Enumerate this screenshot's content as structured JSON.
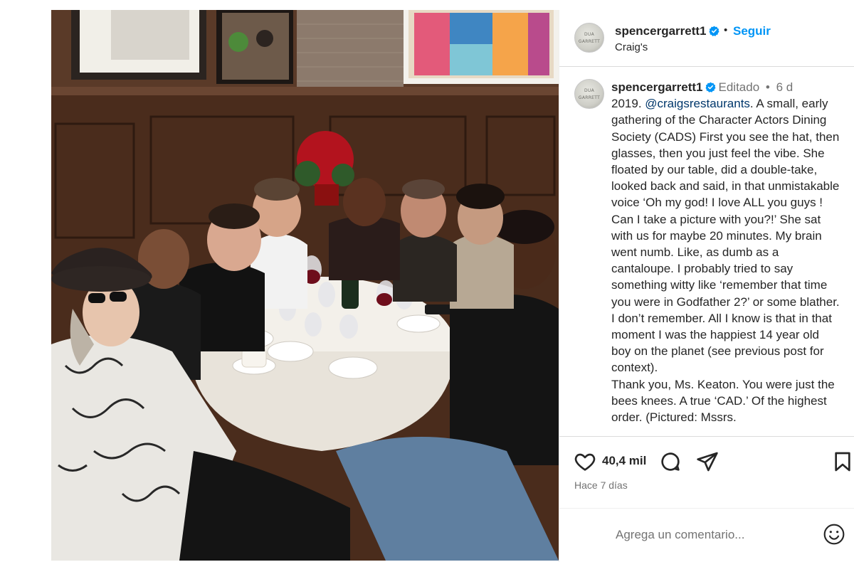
{
  "post": {
    "photo_alt": "",
    "header": {
      "username": "spencergarrett1",
      "dot": "•",
      "follow_label": "Seguir",
      "location": "Craig's",
      "avatar_text": [
        "DUA",
        "GARRETT"
      ]
    },
    "caption": {
      "username": "spencergarrett1",
      "edited": "Editado",
      "dot": "•",
      "age": "6 d",
      "year_prefix": "2019. ",
      "mention": "@craigsrestaurants",
      "text": ". A small, early gathering of the Character Actors Dining Society (CADS) First you see the hat, then glasses, then you just feel the vibe. She floated by our table, did a double-take, looked back and said, in that unmistakable voice ‘Oh my god! I love ALL you guys ! Can I take a picture with you?!’ She sat with us for maybe 20 minutes. My brain went numb. Like, as dumb as a cantaloupe. I probably tried to say something witty like ‘remember that time you were in Godfather 2?’ or some blather. I don’t remember. All I know is that in that moment I was the happiest 14 year old boy on the planet (see previous post for context).",
      "text2": "Thank you, Ms. Keaton. You were just the bees knees. A true ‘CAD.’ Of the highest order. (Pictured: Mssrs."
    },
    "actions": {
      "icons": [
        "heart-icon",
        "comment-icon",
        "share-icon",
        "bookmark-icon"
      ],
      "likes": "40,4 mil",
      "posted": "Hace 7 días"
    },
    "comment": {
      "placeholder": "Agrega un comentario...",
      "icon": "emoji-icon"
    },
    "colors": {
      "link": "#0095f6",
      "mention": "#00376b",
      "verified": "#0095f6",
      "muted": "#737373"
    }
  }
}
